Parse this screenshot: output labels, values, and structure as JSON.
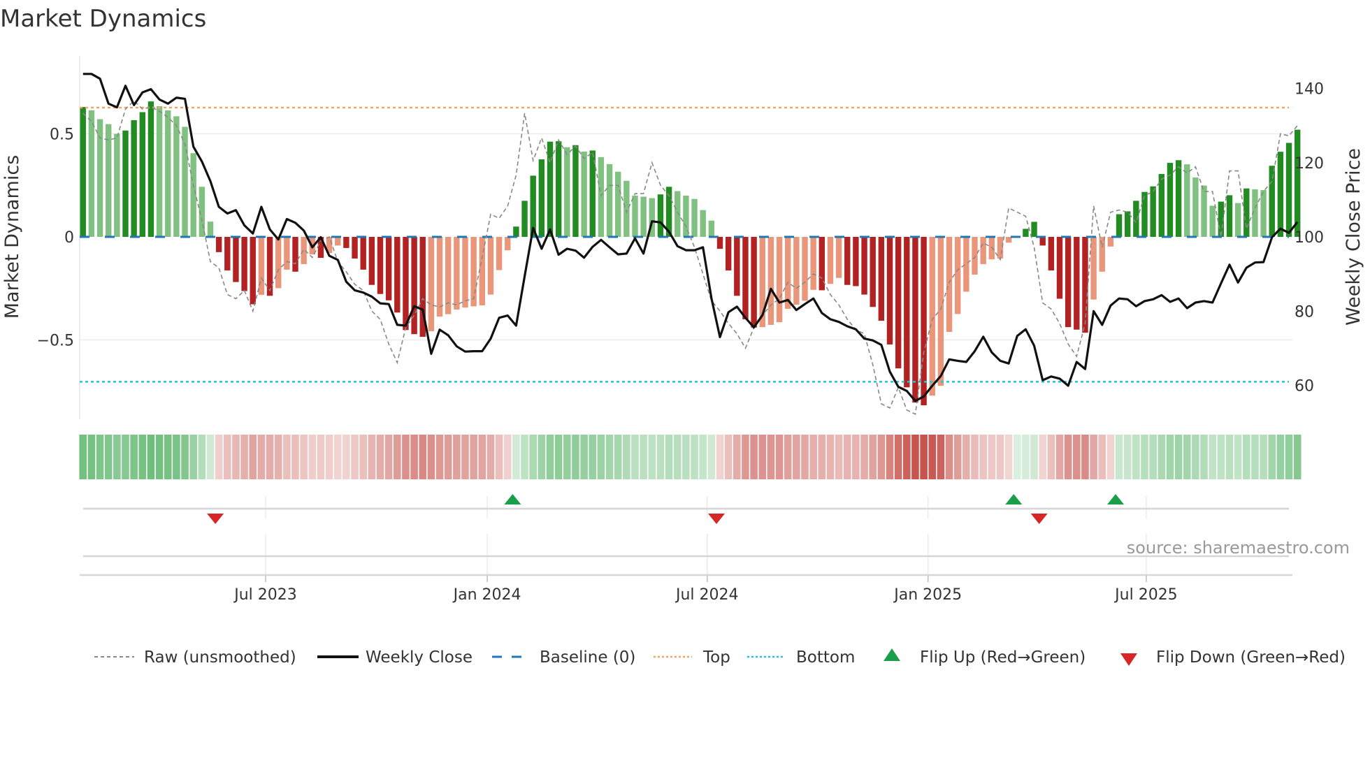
{
  "title": "Market Dynamics",
  "source": "source: sharemaestro.com",
  "colors": {
    "up_strong": "#228b22",
    "up_weak": "#80c080",
    "down_strong": "#b22222",
    "down_weak": "#e9967a",
    "price": "#111111",
    "raw": "#888888",
    "baseline": "#1f77b4",
    "top": "#f4a460",
    "bottom": "#22c6d6",
    "flip_up": "#1a9e4a",
    "flip_down": "#d62728",
    "strip_green": "#4cae5c",
    "strip_red": "#c44a42"
  },
  "chart_data": {
    "type": "bar",
    "title": "Market Dynamics",
    "xlabel": "",
    "ylabel": "Market Dynamics",
    "y2label": "Weekly Close Price",
    "x_unit": "week index (weekly bars, approx. late Jan 2023 to Oct 2025)",
    "ylim": [
      -0.9,
      0.8
    ],
    "y2lim": [
      50,
      143
    ],
    "yticks": [
      {
        "v": 0.5,
        "label": "0.5"
      },
      {
        "v": 0,
        "label": "0"
      },
      {
        "v": -0.5,
        "label": "−0.5"
      }
    ],
    "y2ticks": [
      {
        "v": 140,
        "label": "140"
      },
      {
        "v": 120,
        "label": "120"
      },
      {
        "v": 100,
        "label": "100"
      },
      {
        "v": 80,
        "label": "80"
      },
      {
        "v": 60,
        "label": "60"
      }
    ],
    "xticks": [
      {
        "v": 21.5,
        "label": "Jul 2023"
      },
      {
        "v": 47.6,
        "label": "Jan 2024"
      },
      {
        "v": 73.5,
        "label": "Jul 2024"
      },
      {
        "v": 99.5,
        "label": "Jan 2025"
      },
      {
        "v": 125.2,
        "label": "Jul 2025"
      }
    ],
    "top_level": 0.627,
    "bottom_level": -0.703,
    "baseline": 0,
    "momentum": [
      0.63,
      0.614,
      0.571,
      0.547,
      0.5,
      0.516,
      0.566,
      0.605,
      0.657,
      0.634,
      0.614,
      0.585,
      0.534,
      0.406,
      0.243,
      0.074,
      -0.074,
      -0.163,
      -0.219,
      -0.263,
      -0.327,
      -0.281,
      -0.286,
      -0.249,
      -0.159,
      -0.169,
      -0.132,
      -0.085,
      -0.102,
      -0.078,
      -0.042,
      -0.054,
      -0.105,
      -0.159,
      -0.233,
      -0.277,
      -0.308,
      -0.367,
      -0.452,
      -0.472,
      -0.485,
      -0.458,
      -0.387,
      -0.375,
      -0.353,
      -0.343,
      -0.337,
      -0.332,
      -0.28,
      -0.161,
      -0.065,
      0.05,
      0.175,
      0.297,
      0.376,
      0.462,
      0.464,
      0.435,
      0.445,
      0.414,
      0.419,
      0.387,
      0.353,
      0.316,
      0.272,
      0.2,
      0.195,
      0.188,
      0.206,
      0.243,
      0.222,
      0.2,
      0.184,
      0.13,
      0.079,
      -0.058,
      -0.163,
      -0.286,
      -0.4,
      -0.44,
      -0.438,
      -0.427,
      -0.414,
      -0.349,
      -0.329,
      -0.31,
      -0.257,
      -0.259,
      -0.228,
      -0.199,
      -0.233,
      -0.239,
      -0.28,
      -0.34,
      -0.407,
      -0.522,
      -0.638,
      -0.73,
      -0.804,
      -0.817,
      -0.77,
      -0.723,
      -0.461,
      -0.374,
      -0.266,
      -0.183,
      -0.132,
      -0.109,
      -0.105,
      -0.028,
      0.005,
      0.039,
      0.073,
      -0.042,
      -0.163,
      -0.3,
      -0.438,
      -0.45,
      -0.465,
      -0.304,
      -0.169,
      -0.047,
      0.11,
      0.124,
      0.175,
      0.218,
      0.245,
      0.305,
      0.359,
      0.372,
      0.352,
      0.288,
      0.249,
      0.151,
      0.171,
      0.202,
      0.164,
      0.235,
      0.231,
      0.227,
      0.345,
      0.413,
      0.456,
      0.52
    ],
    "weekly_close": [
      143.9,
      143.9,
      142.6,
      135.9,
      134.9,
      140.7,
      135.5,
      138.9,
      139.8,
      137.0,
      135.9,
      137.5,
      137.2,
      124.3,
      120.3,
      115.0,
      108.1,
      106.3,
      107.2,
      103.1,
      100.9,
      108.1,
      102.0,
      99.3,
      104.8,
      103.8,
      101.7,
      97.2,
      99.9,
      94.9,
      93.8,
      87.9,
      85.6,
      85.0,
      83.9,
      82.1,
      81.9,
      76.3,
      76.1,
      81.3,
      80.4,
      68.5,
      75.0,
      73.5,
      70.5,
      69.1,
      69.2,
      69.2,
      72.6,
      78.2,
      78.8,
      76.1,
      89.4,
      102.4,
      96.8,
      102.0,
      95.2,
      96.8,
      96.3,
      94.4,
      97.3,
      99.2,
      97.2,
      95.3,
      95.5,
      99.6,
      95.5,
      104.2,
      103.9,
      101.4,
      97.5,
      96.4,
      96.4,
      97.2,
      83.4,
      73.0,
      79.7,
      81.2,
      78.2,
      75.6,
      78.9,
      86.0,
      82.3,
      83.0,
      80.3,
      81.9,
      83.4,
      79.5,
      77.8,
      77.1,
      75.9,
      75.1,
      72.6,
      72.1,
      70.9,
      63.7,
      59.6,
      58.5,
      55.8,
      57.0,
      59.9,
      62.5,
      67.0,
      66.6,
      66.3,
      69.2,
      73.1,
      68.9,
      66.6,
      65.9,
      73.3,
      75.1,
      70.7,
      61.4,
      62.4,
      61.8,
      59.9,
      66.3,
      64.4,
      80.0,
      76.3,
      81.5,
      83.4,
      83.2,
      81.3,
      82.7,
      83.2,
      84.3,
      82.5,
      83.4,
      80.8,
      82.3,
      82.7,
      82.3,
      87.5,
      92.5,
      87.7,
      91.7,
      93.1,
      93.2,
      99.9,
      102.2,
      101.1,
      104.0
    ],
    "raw": [
      0.6,
      0.56,
      0.48,
      0.47,
      0.48,
      0.62,
      0.66,
      0.62,
      0.63,
      0.61,
      0.58,
      0.54,
      0.45,
      0.25,
      0.08,
      -0.12,
      -0.15,
      -0.28,
      -0.3,
      -0.26,
      -0.36,
      -0.2,
      -0.26,
      -0.16,
      -0.12,
      -0.13,
      -0.06,
      -0.1,
      -0.02,
      0.0,
      -0.12,
      -0.17,
      -0.23,
      -0.26,
      -0.36,
      -0.4,
      -0.52,
      -0.61,
      -0.44,
      -0.38,
      -0.3,
      -0.33,
      -0.34,
      -0.32,
      -0.33,
      -0.31,
      -0.3,
      -0.1,
      0.11,
      0.09,
      0.15,
      0.3,
      0.6,
      0.37,
      0.48,
      0.36,
      0.47,
      0.4,
      0.44,
      0.38,
      0.41,
      0.2,
      0.25,
      0.25,
      0.12,
      0.21,
      0.21,
      0.36,
      0.25,
      0.2,
      0.12,
      0.05,
      -0.05,
      -0.18,
      -0.31,
      -0.36,
      -0.42,
      -0.47,
      -0.54,
      -0.44,
      -0.38,
      -0.33,
      -0.3,
      -0.22,
      -0.25,
      -0.22,
      -0.18,
      -0.2,
      -0.28,
      -0.33,
      -0.4,
      -0.45,
      -0.47,
      -0.62,
      -0.81,
      -0.83,
      -0.73,
      -0.84,
      -0.86,
      -0.56,
      -0.4,
      -0.35,
      -0.22,
      -0.16,
      -0.13,
      -0.1,
      -0.03,
      -0.05,
      -0.11,
      0.14,
      0.12,
      0.1,
      -0.05,
      -0.32,
      -0.35,
      -0.42,
      -0.52,
      -0.58,
      -0.42,
      0.15,
      -0.05,
      0.12,
      0.13,
      0.12,
      0.07,
      0.2,
      0.22,
      0.28,
      0.3,
      0.34,
      0.31,
      0.34,
      0.22,
      0.22,
      0.0,
      0.32,
      0.32,
      0.04,
      0.14,
      0.22,
      0.27,
      0.5,
      0.49,
      0.54
    ],
    "flips_up": [
      51,
      110,
      122
    ],
    "flips_down": [
      16,
      75,
      113
    ],
    "legend": {
      "placement": "bottom",
      "raw": "Raw (unsmoothed)",
      "close": "Weekly Close",
      "baseline": "Baseline (0)",
      "top": "Top",
      "bottom": "Bottom",
      "flip_up": "Flip Up (Red→Green)",
      "flip_down": "Flip Down (Green→Red)"
    }
  }
}
